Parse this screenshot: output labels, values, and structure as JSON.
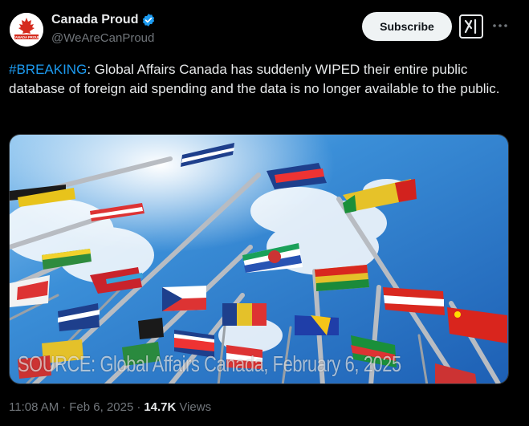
{
  "author": {
    "display_name": "Canada Proud",
    "handle": "@WeAreCanProud",
    "avatar_text": "CANADA PROUD",
    "verified": true
  },
  "actions": {
    "subscribe_label": "Subscribe",
    "grok_icon": "grok-icon",
    "more_icon": "more-icon"
  },
  "post": {
    "hashtag": "#BREAKING",
    "body": ": Global Affairs Canada has suddenly WIPED their entire public database of foreign aid spending and the data is no longer available to the public.",
    "image_caption": "SOURCE: Global Affairs Canada, February 6, 2025"
  },
  "meta": {
    "time": "11:08 AM",
    "separator": "·",
    "date": "Feb 6, 2025",
    "views_count": "14.7K",
    "views_label": "Views"
  },
  "colors": {
    "background": "#000000",
    "link": "#1d9bf0",
    "verified": "#1d9bf0",
    "muted": "#71767b",
    "text": "#e7e9ea"
  }
}
